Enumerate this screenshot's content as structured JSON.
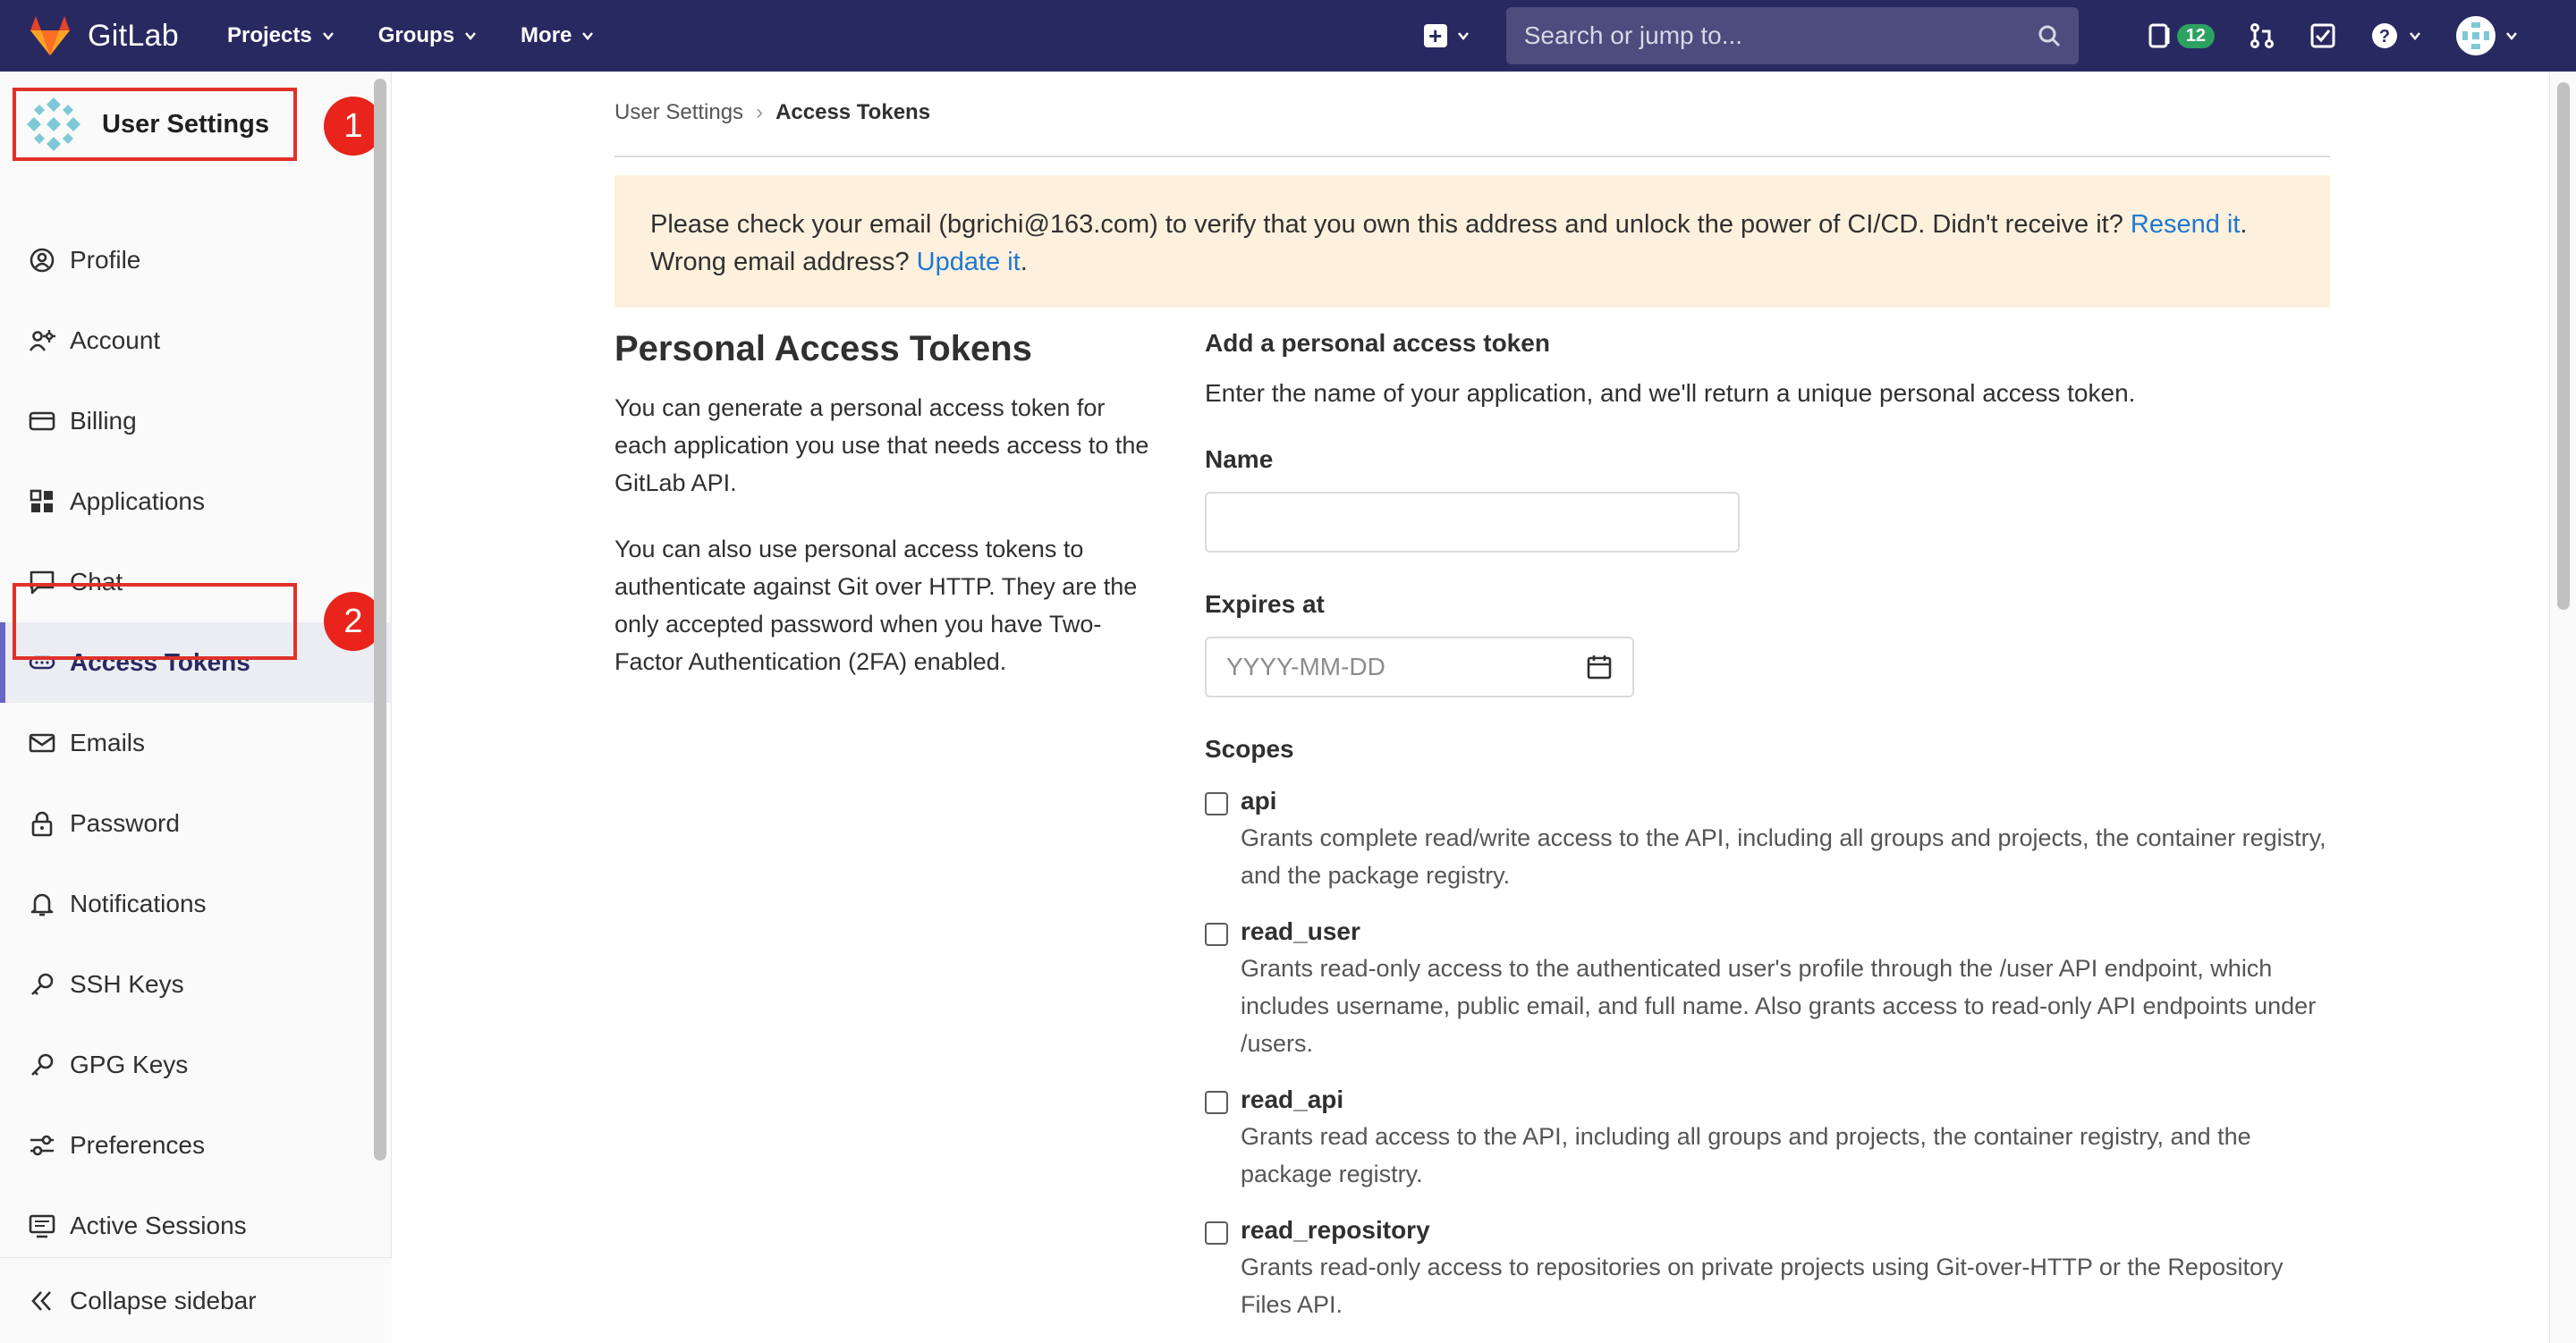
{
  "topbar": {
    "brand": "GitLab",
    "nav": [
      {
        "label": "Projects"
      },
      {
        "label": "Groups"
      },
      {
        "label": "More"
      }
    ],
    "search_placeholder": "Search or jump to...",
    "issues_count": "12",
    "colors": {
      "bar": "#292961",
      "badge": "#2da160"
    }
  },
  "sidebar": {
    "title": "User Settings",
    "items": [
      {
        "label": "Profile",
        "icon": "profile-icon"
      },
      {
        "label": "Account",
        "icon": "account-icon"
      },
      {
        "label": "Billing",
        "icon": "credit-card-icon"
      },
      {
        "label": "Applications",
        "icon": "applications-icon"
      },
      {
        "label": "Chat",
        "icon": "chat-icon"
      },
      {
        "label": "Access Tokens",
        "icon": "token-icon",
        "active": true
      },
      {
        "label": "Emails",
        "icon": "mail-icon"
      },
      {
        "label": "Password",
        "icon": "lock-icon"
      },
      {
        "label": "Notifications",
        "icon": "bell-icon"
      },
      {
        "label": "SSH Keys",
        "icon": "key-icon"
      },
      {
        "label": "GPG Keys",
        "icon": "key-icon"
      },
      {
        "label": "Preferences",
        "icon": "preferences-icon"
      },
      {
        "label": "Active Sessions",
        "icon": "monitor-icon"
      }
    ],
    "collapse_label": "Collapse sidebar"
  },
  "callouts": {
    "one": "1",
    "two": "2"
  },
  "breadcrumb": {
    "parent": "User Settings",
    "separator": "›",
    "current": "Access Tokens"
  },
  "alert": {
    "text_before": "Please check your email (bgrichi@163.com) to verify that you own this address and unlock the power of CI/CD. Didn't receive it? ",
    "resend_link": "Resend it",
    "text_mid": ".",
    "wrong_text": "Wrong email address? ",
    "update_link": "Update it",
    "text_end": "."
  },
  "intro": {
    "title": "Personal Access Tokens",
    "p1": "You can generate a personal access token for each application you use that needs access to the GitLab API.",
    "p2": "You can also use personal access tokens to authenticate against Git over HTTP. They are the only accepted password when you have Two-Factor Authentication (2FA) enabled."
  },
  "form": {
    "heading": "Add a personal access token",
    "description": "Enter the name of your application, and we'll return a unique personal access token.",
    "name_label": "Name",
    "name_value": "",
    "expires_label": "Expires at",
    "expires_placeholder": "YYYY-MM-DD",
    "scopes_label": "Scopes",
    "scopes": [
      {
        "name": "api",
        "checked": false,
        "description": "Grants complete read/write access to the API, including all groups and projects, the container registry, and the package registry."
      },
      {
        "name": "read_user",
        "checked": false,
        "description": "Grants read-only access to the authenticated user's profile through the /user API endpoint, which includes username, public email, and full name. Also grants access to read-only API endpoints under /users."
      },
      {
        "name": "read_api",
        "checked": false,
        "description": "Grants read access to the API, including all groups and projects, the container registry, and the package registry."
      },
      {
        "name": "read_repository",
        "checked": false,
        "description": "Grants read-only access to repositories on private projects using Git-over-HTTP or the Repository Files API."
      }
    ]
  }
}
